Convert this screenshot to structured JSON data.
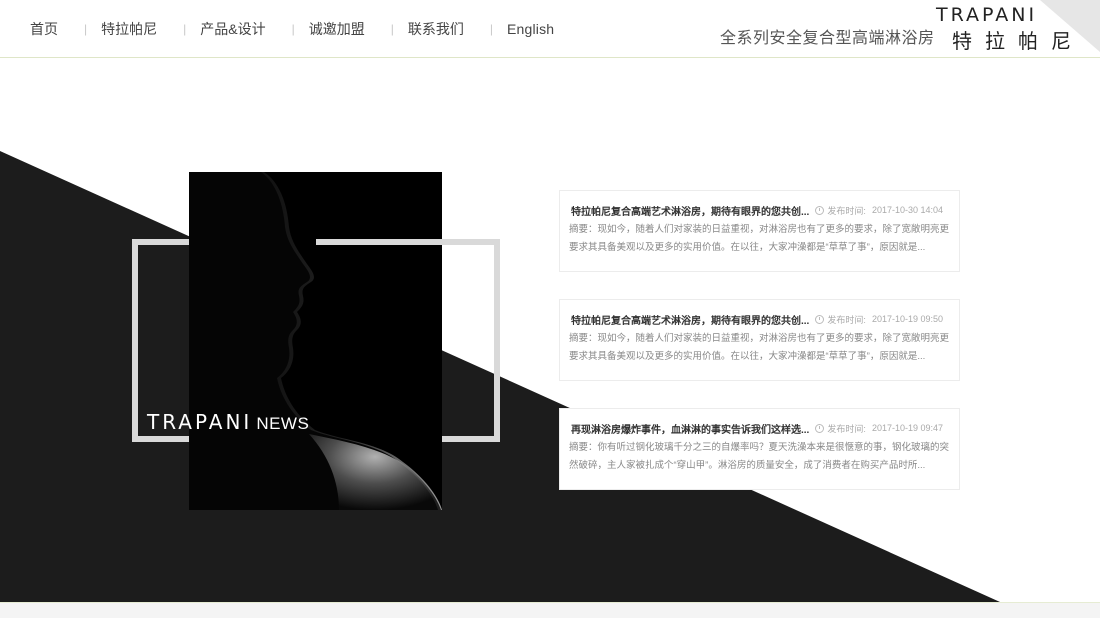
{
  "nav": {
    "items": [
      {
        "label": "首页"
      },
      {
        "label": "特拉帕尼"
      },
      {
        "label": "产品&设计"
      },
      {
        "label": "诚邀加盟"
      },
      {
        "label": "联系我们"
      },
      {
        "label": "English"
      }
    ],
    "separator": "|"
  },
  "header": {
    "tagline": "全系列安全复合型高端淋浴房",
    "logo_en": "TRAPANI",
    "logo_cn": "特拉帕尼"
  },
  "hero": {
    "brand": "TRAPANI",
    "section_word": "NEWS"
  },
  "news": [
    {
      "title": "特拉帕尼复合高端艺术淋浴房，期待有眼界的您共创...",
      "date_label": "发布时间:",
      "date": "2017-10-30 14:04",
      "summary": "摘要：现如今，随着人们对家装的日益重视，对淋浴房也有了更多的要求，除了宽敞明亮更要求其具备美观以及更多的实用价值。在以往，大家冲澡都是“草草了事”，原因就是..."
    },
    {
      "title": "特拉帕尼复合高端艺术淋浴房，期待有眼界的您共创...",
      "date_label": "发布时间:",
      "date": "2017-10-19 09:50",
      "summary": "摘要：现如今，随着人们对家装的日益重视，对淋浴房也有了更多的要求，除了宽敞明亮更要求其具备美观以及更多的实用价值。在以往，大家冲澡都是“草草了事”，原因就是..."
    },
    {
      "title": "再现淋浴房爆炸事件，血淋淋的事实告诉我们这样选...",
      "date_label": "发布时间:",
      "date": "2017-10-19 09:47",
      "summary": "摘要：你有听过钢化玻璃千分之三的自爆率吗？夏天洗澡本来是很惬意的事，钢化玻璃的突然破碎，主人家被扎成个“穿山甲”。淋浴房的质量安全，成了消费者在购买产品时所..."
    }
  ],
  "colors": {
    "dark_band": "#1c1c1c",
    "frame": "#d9d9d9",
    "header_line": "#dfe6c8"
  },
  "icons": {
    "date": "clock-icon"
  }
}
